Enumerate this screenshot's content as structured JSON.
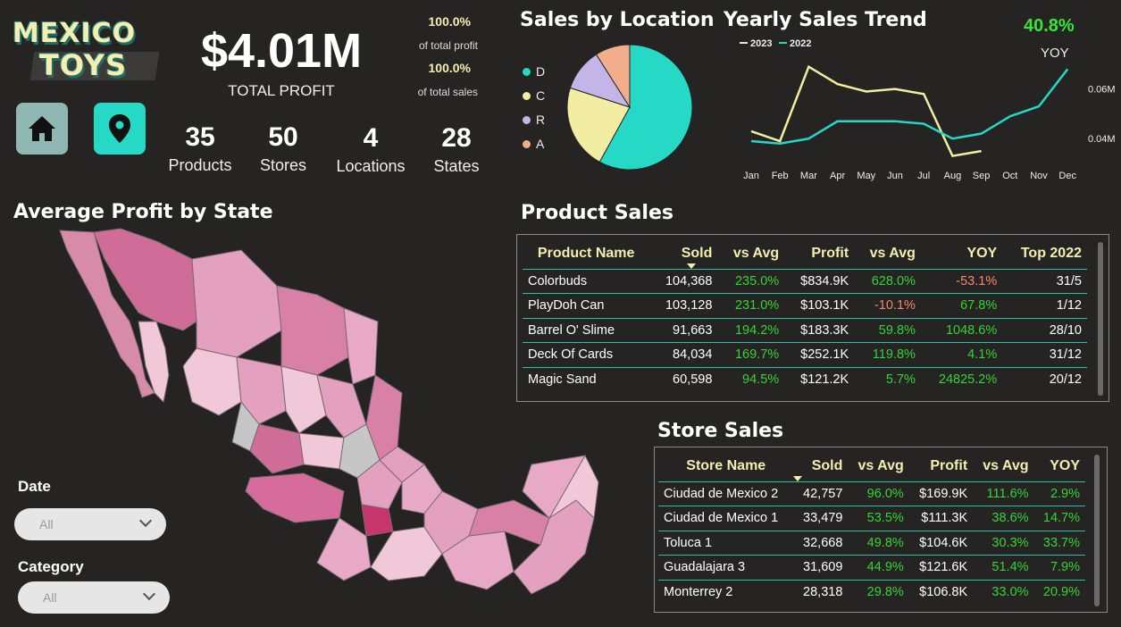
{
  "brand": {
    "line1": "MEXICO",
    "line2": "TOYS"
  },
  "kpi": {
    "total_profit": "$4.01M",
    "total_profit_label": "TOTAL PROFIT",
    "profit_pct": "100.0%",
    "profit_pct_label": "of total profit",
    "sales_pct": "100.0%",
    "sales_pct_label": "of total sales"
  },
  "nav": {
    "home_icon": "home-icon",
    "location_icon": "map-pin-icon"
  },
  "stats": [
    {
      "value": "35",
      "label": "Products"
    },
    {
      "value": "50",
      "label": "Stores"
    },
    {
      "value": "4",
      "label": "Locations"
    },
    {
      "value": "28",
      "label": "States"
    }
  ],
  "sales_by_location": {
    "title": "Sales by Location",
    "chart_data": {
      "type": "pie",
      "labels": [
        "D",
        "C",
        "R",
        "A"
      ],
      "values": [
        58,
        22,
        11,
        9
      ],
      "colors": [
        "#26d9c7",
        "#f2eda3",
        "#c4b5e8",
        "#f2ad8a"
      ]
    }
  },
  "yearly_trend": {
    "title": "Yearly Sales Trend",
    "yoy_value": "40.8%",
    "yoy_label": "YOY",
    "chart_data": {
      "type": "line",
      "categories": [
        "Jan",
        "Feb",
        "Mar",
        "Apr",
        "May",
        "Jun",
        "Jul",
        "Aug",
        "Sep",
        "Oct",
        "Nov",
        "Dec"
      ],
      "y_ticks": [
        "0.06M",
        "0.04M"
      ],
      "series": [
        {
          "name": "2023",
          "color": "#f2eda3",
          "values": [
            0.043,
            0.039,
            0.069,
            0.062,
            0.059,
            0.06,
            0.058,
            0.033,
            0.035,
            null,
            null,
            null
          ]
        },
        {
          "name": "2022",
          "color": "#26d9c7",
          "values": [
            0.039,
            0.038,
            0.04,
            0.047,
            0.047,
            0.047,
            0.046,
            0.04,
            0.042,
            0.049,
            0.053,
            0.068
          ]
        }
      ],
      "ylim": [
        0.03,
        0.075
      ]
    }
  },
  "map": {
    "title": "Average Profit by State"
  },
  "filters": {
    "date_label": "Date",
    "date_value": "All",
    "category_label": "Category",
    "category_value": "All"
  },
  "product_sales": {
    "title": "Product Sales",
    "headers": [
      "Product Name",
      "Sold",
      "vs Avg",
      "Profit",
      "vs Avg",
      "YOY",
      "Top 2022"
    ],
    "rows": [
      [
        "Colorbuds",
        "104,368",
        "235.0%",
        "$834.9K",
        "628.0%",
        "-53.1%",
        "31/5"
      ],
      [
        "PlayDoh Can",
        "103,128",
        "231.0%",
        "$103.1K",
        "-10.1%",
        "67.8%",
        "1/12"
      ],
      [
        "Barrel O' Slime",
        "91,663",
        "194.2%",
        "$183.3K",
        "59.8%",
        "1048.6%",
        "28/10"
      ],
      [
        "Deck Of Cards",
        "84,034",
        "169.7%",
        "$252.1K",
        "119.8%",
        "4.1%",
        "31/12"
      ],
      [
        "Magic Sand",
        "60,598",
        "94.5%",
        "$121.2K",
        "5.7%",
        "24825.2%",
        "20/12"
      ]
    ],
    "neg_cells": [
      [
        0,
        5
      ],
      [
        1,
        4
      ]
    ]
  },
  "store_sales": {
    "title": "Store Sales",
    "headers": [
      "Store Name",
      "Sold",
      "vs Avg",
      "Profit",
      "vs Avg",
      "YOY"
    ],
    "rows": [
      [
        "Ciudad de Mexico 2",
        "42,757",
        "96.0%",
        "$169.9K",
        "111.6%",
        "2.9%"
      ],
      [
        "Ciudad de Mexico 1",
        "33,479",
        "53.5%",
        "$111.3K",
        "38.6%",
        "14.7%"
      ],
      [
        "Toluca 1",
        "32,668",
        "49.8%",
        "$104.6K",
        "30.3%",
        "33.7%"
      ],
      [
        "Guadalajara 3",
        "31,609",
        "44.9%",
        "$121.6K",
        "51.4%",
        "7.9%"
      ],
      [
        "Monterrey 2",
        "28,318",
        "29.8%",
        "$106.8K",
        "33.0%",
        "20.9%"
      ]
    ]
  }
}
